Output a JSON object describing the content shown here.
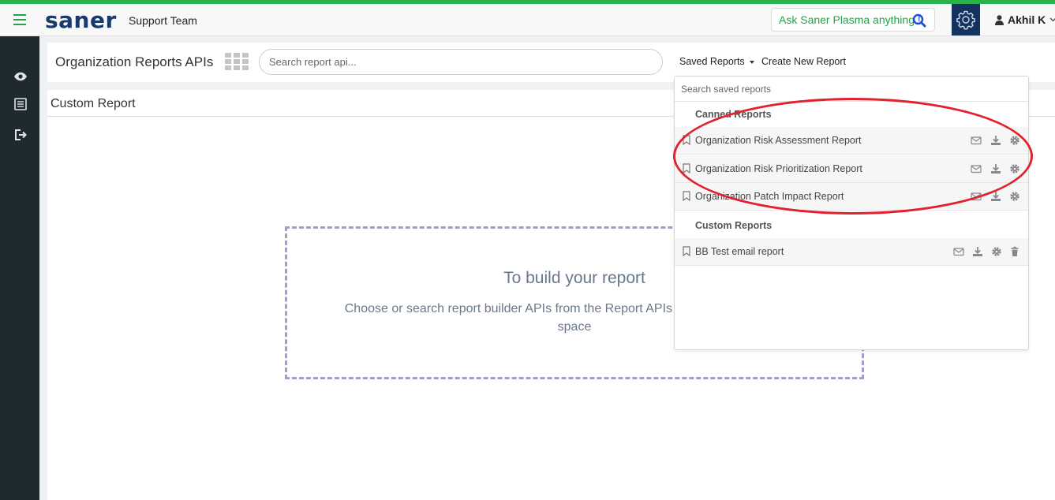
{
  "header": {
    "logo": "saner",
    "team": "Support Team",
    "ask_text": "Ask Saner Plasma anything",
    "ask_mark": "!",
    "user": "Akhil K"
  },
  "icons": {
    "menu": "hamburger-icon",
    "ask": "search-icon",
    "settings": "gear-icon",
    "user": "person-icon",
    "sidebar": [
      "eye-icon",
      "report-list-icon",
      "logout-icon"
    ],
    "row_actions": [
      "email-icon",
      "download-icon",
      "settings-icon",
      "delete-icon"
    ]
  },
  "toolbar": {
    "title": "Organization Reports APIs",
    "search_placeholder": "Search report api...",
    "saved_reports": "Saved Reports",
    "create_new": "Create New Report"
  },
  "content": {
    "title": "Custom Report",
    "dropzone_title": "To build your report",
    "dropzone_sub": "Choose or search report builder APIs from the Report APIs and drag them into this space"
  },
  "saved_dropdown": {
    "search_placeholder": "Search saved reports",
    "canned_heading": "Canned Reports",
    "canned": [
      "Organization Risk Assessment Report",
      "Organization Risk Prioritization Report",
      "Organization Patch Impact Report"
    ],
    "custom_heading": "Custom Reports",
    "custom": [
      "BB Test email report"
    ]
  },
  "colors": {
    "brand_green": "#27b24a",
    "brand_navy": "#13325e",
    "highlight": "#e2212c",
    "dropzone_border": "#a79bcd"
  }
}
